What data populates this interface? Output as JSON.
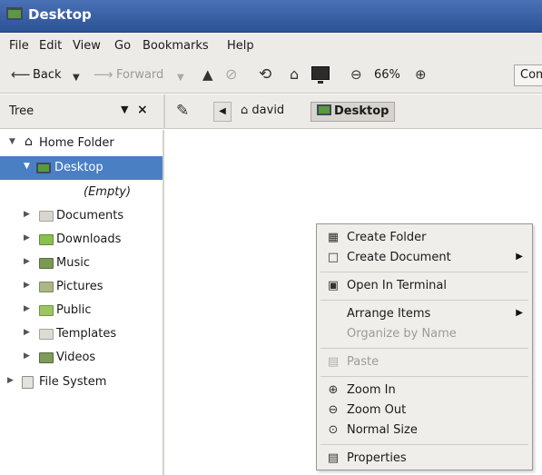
{
  "window": {
    "title": "Desktop"
  },
  "menubar": [
    "File",
    "Edit",
    "View",
    "Go",
    "Bookmarks",
    "Help"
  ],
  "toolbar": {
    "back_label": "Back",
    "forward_label": "Forward",
    "zoom_level": "66%",
    "location_fragment": "Com"
  },
  "sidebar": {
    "title": "Tree",
    "items": [
      {
        "label": "Home Folder",
        "icon": "home-icon"
      },
      {
        "label": "Desktop",
        "icon": "desktop-folder-icon"
      },
      {
        "label": "(Empty)"
      },
      {
        "label": "Documents",
        "icon": "documents-folder-icon"
      },
      {
        "label": "Downloads",
        "icon": "downloads-folder-icon"
      },
      {
        "label": "Music",
        "icon": "music-folder-icon"
      },
      {
        "label": "Pictures",
        "icon": "pictures-folder-icon"
      },
      {
        "label": "Public",
        "icon": "public-folder-icon"
      },
      {
        "label": "Templates",
        "icon": "templates-folder-icon"
      },
      {
        "label": "Videos",
        "icon": "videos-folder-icon"
      },
      {
        "label": "File System",
        "icon": "drive-icon"
      }
    ]
  },
  "pathbar": {
    "parent": "david",
    "current": "Desktop"
  },
  "context_menu": {
    "items": [
      {
        "label": "Create Folder",
        "icon": "new-folder-icon",
        "enabled": true
      },
      {
        "label": "Create Document",
        "icon": "new-document-icon",
        "enabled": true,
        "submenu": true
      },
      {
        "label": "Open In Terminal",
        "icon": "terminal-icon",
        "enabled": true
      },
      {
        "label": "Arrange Items",
        "enabled": true,
        "submenu": true
      },
      {
        "label": "Organize by Name",
        "enabled": false
      },
      {
        "label": "Paste",
        "icon": "paste-icon",
        "enabled": false
      },
      {
        "label": "Zoom In",
        "icon": "zoom-in-icon",
        "enabled": true
      },
      {
        "label": "Zoom Out",
        "icon": "zoom-out-icon",
        "enabled": true
      },
      {
        "label": "Normal Size",
        "icon": "zoom-normal-icon",
        "enabled": true
      },
      {
        "label": "Properties",
        "icon": "properties-icon",
        "enabled": true
      }
    ]
  },
  "colors": {
    "titlebar": "#2c5296",
    "selection": "#4a7fc4",
    "chrome": "#edebe8"
  }
}
